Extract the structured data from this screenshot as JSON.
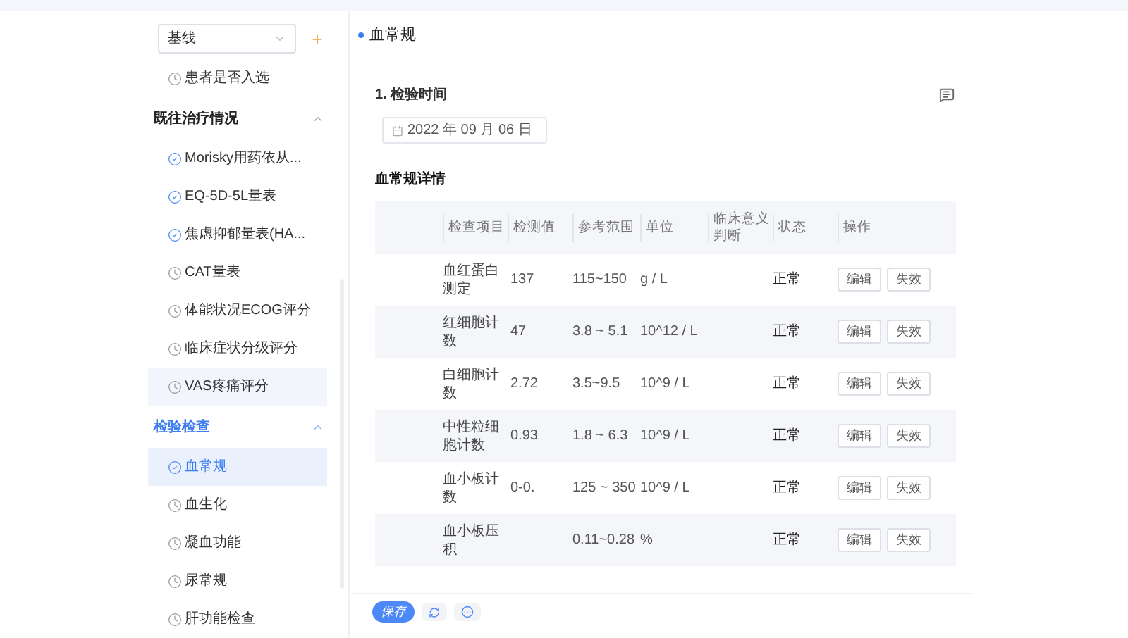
{
  "sidebar": {
    "stage_select": {
      "value": "基线"
    },
    "top_items": [
      {
        "label": "患者是否入选",
        "kind": "pending",
        "selected": false,
        "highlighted": false
      }
    ],
    "sections": [
      {
        "title": "既往治疗情况",
        "expanded": true,
        "active": false,
        "items": [
          {
            "label": "Morisky用药依从...",
            "kind": "done",
            "selected": false,
            "highlighted": false
          },
          {
            "label": "EQ-5D-5L量表",
            "kind": "done",
            "selected": false,
            "highlighted": false
          },
          {
            "label": "焦虑抑郁量表(HA...",
            "kind": "done",
            "selected": false,
            "highlighted": false
          },
          {
            "label": "CAT量表",
            "kind": "pending",
            "selected": false,
            "highlighted": false
          },
          {
            "label": "体能状况ECOG评分",
            "kind": "pending",
            "selected": false,
            "highlighted": false
          },
          {
            "label": "临床症状分级评分",
            "kind": "pending",
            "selected": false,
            "highlighted": false
          },
          {
            "label": "VAS疼痛评分",
            "kind": "pending",
            "selected": false,
            "highlighted": true
          }
        ]
      },
      {
        "title": "检验检查",
        "expanded": true,
        "active": true,
        "items": [
          {
            "label": "血常规",
            "kind": "done",
            "selected": true,
            "highlighted": false
          },
          {
            "label": "血生化",
            "kind": "pending",
            "selected": false,
            "highlighted": false
          },
          {
            "label": "凝血功能",
            "kind": "pending",
            "selected": false,
            "highlighted": false
          },
          {
            "label": "尿常规",
            "kind": "pending",
            "selected": false,
            "highlighted": false
          },
          {
            "label": "肝功能检查",
            "kind": "pending",
            "selected": false,
            "highlighted": false
          }
        ]
      }
    ]
  },
  "main": {
    "title": "血常规",
    "question": {
      "label": "1. 检验时间",
      "date": "2022 年 09 月 06 日"
    },
    "table_title": "血常规详情",
    "table": {
      "columns": [
        "检查项目",
        "检测值",
        "参考范围",
        "单位",
        "临床意义判断",
        "状态",
        "操作"
      ],
      "rows": [
        {
          "item": "血红蛋白测定",
          "value": "137",
          "range": "115~150",
          "unit": "g / L",
          "status": "正常",
          "actions": [
            "编辑",
            "失效"
          ]
        },
        {
          "item": "红细胞计数",
          "value": "47",
          "range": "3.8 ~ 5.1",
          "unit": "10^12 / L",
          "status": "正常",
          "actions": [
            "编辑",
            "失效"
          ]
        },
        {
          "item": "白细胞计数",
          "value": "2.72",
          "range": "3.5~9.5",
          "unit": "10^9 / L",
          "status": "正常",
          "actions": [
            "编辑",
            "失效"
          ]
        },
        {
          "item": "中性粒细胞计数",
          "value": "0.93",
          "range": "1.8 ~ 6.3",
          "unit": "10^9 / L",
          "status": "正常",
          "actions": [
            "编辑",
            "失效"
          ]
        },
        {
          "item": "血小板计数",
          "value": "0-0.",
          "range": "125 ~ 350",
          "unit": "10^9 / L",
          "status": "正常",
          "actions": [
            "编辑",
            "失效"
          ]
        },
        {
          "item": "血小板压积",
          "range": "0.11~0.28",
          "unit": "%",
          "status": "正常",
          "actions": [
            "编辑",
            "失效"
          ]
        }
      ]
    },
    "footer": {
      "save": "保存"
    }
  }
}
